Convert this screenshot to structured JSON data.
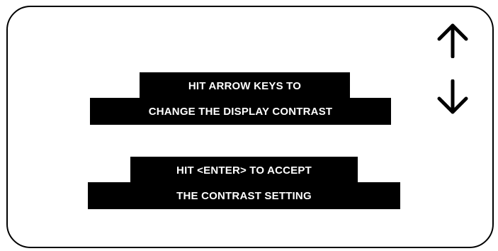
{
  "instructions": {
    "line1": "HIT ARROW KEYS TO",
    "line2": "CHANGE THE DISPLAY CONTRAST",
    "line3": "HIT <ENTER> TO ACCEPT",
    "line4": "THE CONTRAST SETTING"
  },
  "icons": {
    "up": "arrow-up-icon",
    "down": "arrow-down-icon"
  },
  "colors": {
    "banner_background": "#000000",
    "banner_text": "#ffffff",
    "panel_border": "#000000"
  }
}
